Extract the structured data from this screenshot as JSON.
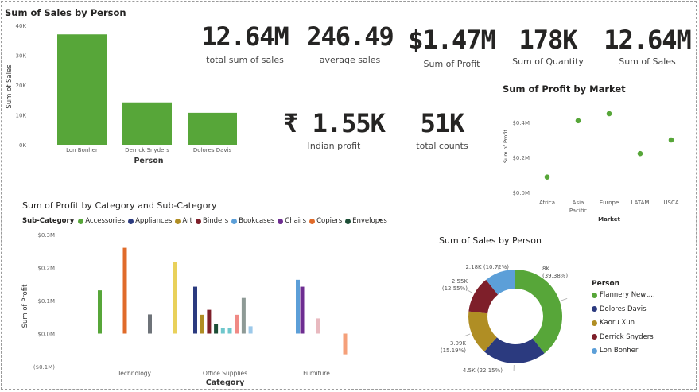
{
  "cards": [
    {
      "value": "12.64M",
      "label": "total sum of sales"
    },
    {
      "value": "246.49",
      "label": "average sales"
    },
    {
      "value": "$1.47M",
      "label": "Sum of Profit"
    },
    {
      "value": "178K",
      "label": "Sum of Quantity"
    },
    {
      "value": "12.64M",
      "label": "Sum of Sales"
    },
    {
      "value": "₹ 1.55K",
      "label": "Indian profit"
    },
    {
      "value": "51K",
      "label": "total counts"
    }
  ],
  "colors": {
    "green": "#57A639",
    "navy": "#2B3A7F",
    "olive": "#B08E24",
    "maroon": "#7E1F2A",
    "lightblue": "#5C9FD8",
    "purple": "#6E2D91",
    "orange": "#E06B2A",
    "darkgreen": "#1C4E36",
    "gray": "#6E7379",
    "yellow": "#E9D15B",
    "teal": "#6FC7CC",
    "salmon": "#F08A85",
    "graygreen": "#8E9A96",
    "paleblue": "#9CC9EA",
    "pink": "#E8B9BF",
    "peach": "#F5A07A"
  },
  "bar_chart": {
    "title": "Sum of Sales by Person",
    "y_axis_label": "Sum of Sales",
    "x_axis_label": "Person",
    "chart_data": {
      "type": "bar",
      "title": "Sum of Sales by Person",
      "xlabel": "Person",
      "ylabel": "Sum of Sales",
      "categories": [
        "Lon Bonher",
        "Derrick Snyders",
        "Dolores Davis"
      ],
      "values": [
        37000,
        14200,
        10700
      ],
      "ylim": [
        0,
        40000
      ],
      "ticks": [
        {
          "value": 0,
          "label": "0K"
        },
        {
          "value": 10000,
          "label": "10K"
        },
        {
          "value": 20000,
          "label": "20K"
        },
        {
          "value": 30000,
          "label": "30K"
        },
        {
          "value": 40000,
          "label": "40K"
        }
      ],
      "color": "#57A639"
    }
  },
  "market_chart": {
    "title": "Sum of Profit by Market",
    "x_axis_label": "Market",
    "y_axis_label": "Sum of Profit",
    "chart_data": {
      "type": "scatter",
      "title": "Sum of Profit by Market",
      "xlabel": "Market",
      "ylabel": "Sum of Profit",
      "categories": [
        "Africa",
        "Asia Pacific",
        "Europe",
        "LATAM",
        "USCA"
      ],
      "values": [
        88000,
        410000,
        450000,
        222000,
        300000
      ],
      "ylim": [
        0,
        500000
      ],
      "ticks": [
        {
          "value": 0,
          "label": "$0.0M"
        },
        {
          "value": 200000,
          "label": "$0.2M"
        },
        {
          "value": 400000,
          "label": "$0.4M"
        }
      ],
      "color": "#57A639"
    }
  },
  "category_chart": {
    "title": "Sum of Profit by Category and Sub-Category",
    "legend_title": "Sub-Category",
    "legend": [
      {
        "name": "Accessories",
        "color": "#57A639"
      },
      {
        "name": "Appliances",
        "color": "#2B3A7F"
      },
      {
        "name": "Art",
        "color": "#B08E24"
      },
      {
        "name": "Binders",
        "color": "#7E1F2A"
      },
      {
        "name": "Bookcases",
        "color": "#5C9FD8"
      },
      {
        "name": "Chairs",
        "color": "#6E2D91"
      },
      {
        "name": "Copiers",
        "color": "#E06B2A"
      },
      {
        "name": "Envelopes",
        "color": "#1C4E36"
      }
    ],
    "legend_more": "▸",
    "x_axis_label": "Category",
    "y_axis_label": "Sum of Profit",
    "chart_data": {
      "type": "bar",
      "title": "Sum of Profit by Category and Sub-Category",
      "xlabel": "Category",
      "ylabel": "Sum of Profit",
      "ylim": [
        -100000,
        300000
      ],
      "ticks": [
        {
          "value": -100000,
          "label": "($0.1M)"
        },
        {
          "value": 0,
          "label": "$0.0M"
        },
        {
          "value": 100000,
          "label": "$0.1M"
        },
        {
          "value": 200000,
          "label": "$0.2M"
        },
        {
          "value": 300000,
          "label": "$0.3M"
        }
      ],
      "categories": [
        "Technology",
        "Office Supplies",
        "Furniture"
      ],
      "groups": [
        {
          "category": "Technology",
          "bars": [
            {
              "value": 131000,
              "color": "#57A639"
            },
            {
              "value": 260000,
              "color": "#E06B2A"
            },
            {
              "value": 58000,
              "color": "#6E7379"
            },
            {
              "value": 218000,
              "color": "#E9D15B"
            }
          ]
        },
        {
          "category": "Office Supplies",
          "bars": [
            {
              "value": 142000,
              "color": "#2B3A7F"
            },
            {
              "value": 57000,
              "color": "#B08E24"
            },
            {
              "value": 72000,
              "color": "#7E1F2A"
            },
            {
              "value": 28000,
              "color": "#1C4E36"
            },
            {
              "value": 17000,
              "color": "#6FC7CC"
            },
            {
              "value": 17000,
              "color": "#6FC7CC"
            },
            {
              "value": 57000,
              "color": "#F08A85"
            },
            {
              "value": 108000,
              "color": "#8E9A96"
            },
            {
              "value": 22000,
              "color": "#9CC9EA"
            }
          ]
        },
        {
          "category": "Furniture",
          "bars": [
            {
              "value": 163000,
              "color": "#5C9FD8"
            },
            {
              "value": 142000,
              "color": "#6E2D91"
            },
            {
              "value": 46000,
              "color": "#E8B9BF"
            },
            {
              "value": -63000,
              "color": "#F5A07A"
            }
          ]
        }
      ]
    }
  },
  "donut_chart": {
    "title": "Sum of Sales by Person",
    "legend_title": "Person",
    "chart_data": {
      "type": "pie",
      "title": "Sum of Sales by Person",
      "slices": [
        {
          "name": "Flannery Newt...",
          "value": 8000,
          "label": "8K",
          "pct": "(39.38%)",
          "color": "#57A639"
        },
        {
          "name": "Dolores Davis",
          "value": 4500,
          "label": "4.5K (22.15%)",
          "pct": "",
          "color": "#2B3A7F"
        },
        {
          "name": "Kaoru Xun",
          "value": 3090,
          "label": "3.09K",
          "pct": "(15.19%)",
          "color": "#B08E24"
        },
        {
          "name": "Derrick Snyders",
          "value": 2550,
          "label": "2.55K",
          "pct": "(12.55%)",
          "color": "#7E1F2A"
        },
        {
          "name": "Lon Bonher",
          "value": 2180,
          "label": "2.18K (10.72%)",
          "pct": "",
          "color": "#5C9FD8"
        }
      ]
    }
  }
}
